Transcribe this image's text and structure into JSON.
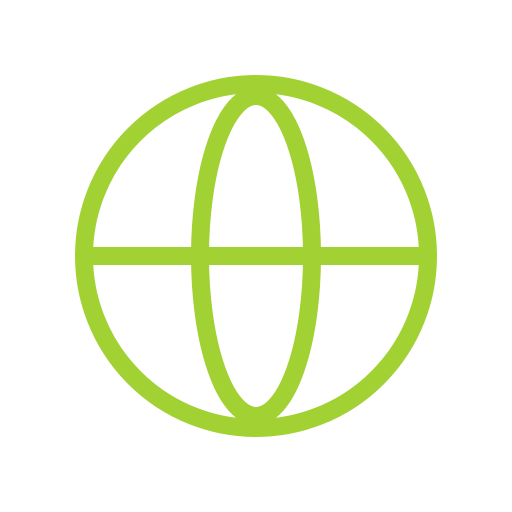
{
  "icon": {
    "name": "globe-icon",
    "color": "#a2d133",
    "background": "#ffffff"
  }
}
